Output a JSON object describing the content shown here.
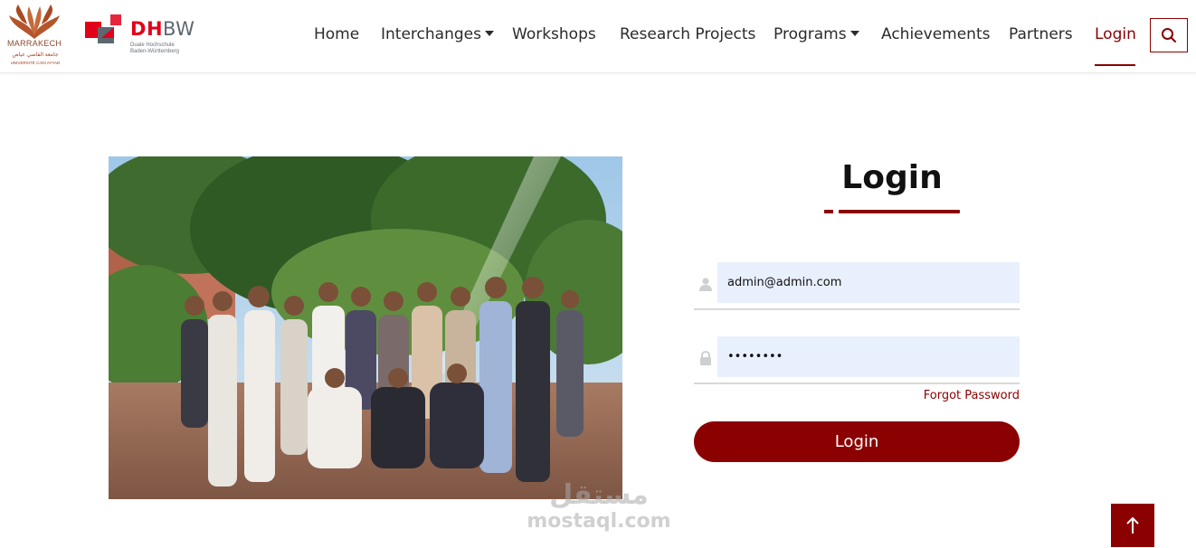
{
  "brand": {
    "cadi_logo_text": "MARRAKECH",
    "cadi_logo_arabic": "جامعة القاضي عياض",
    "cadi_logo_sub": "UNIVERSITÉ CADI AYYAD",
    "dhbw_d": "D",
    "dhbw_h": "H",
    "dhbw_bw": "BW",
    "dhbw_sub_1": "Duale Hochschule",
    "dhbw_sub_2": "Baden-Württemberg"
  },
  "nav": {
    "items": [
      {
        "label": "Home"
      },
      {
        "label": "Interchanges"
      },
      {
        "label": "Workshops"
      },
      {
        "label": "Research Projects"
      },
      {
        "label": "Programs"
      },
      {
        "label": "Achievements"
      },
      {
        "label": "Partners"
      },
      {
        "label": "Login"
      }
    ],
    "search_icon": "search-icon"
  },
  "login": {
    "title": "Login",
    "email_value": "admin@admin.com",
    "password_value": "••••••••",
    "forgot_label": "Forgot Password",
    "submit_label": "Login"
  },
  "watermark": {
    "arabic": "مستقل",
    "latin": "mostaql.com"
  },
  "colors": {
    "accent": "#8b0000",
    "input_bg": "#e8f0fe",
    "text": "#2b2b2b"
  },
  "back_to_top_icon": "arrow-up-icon"
}
